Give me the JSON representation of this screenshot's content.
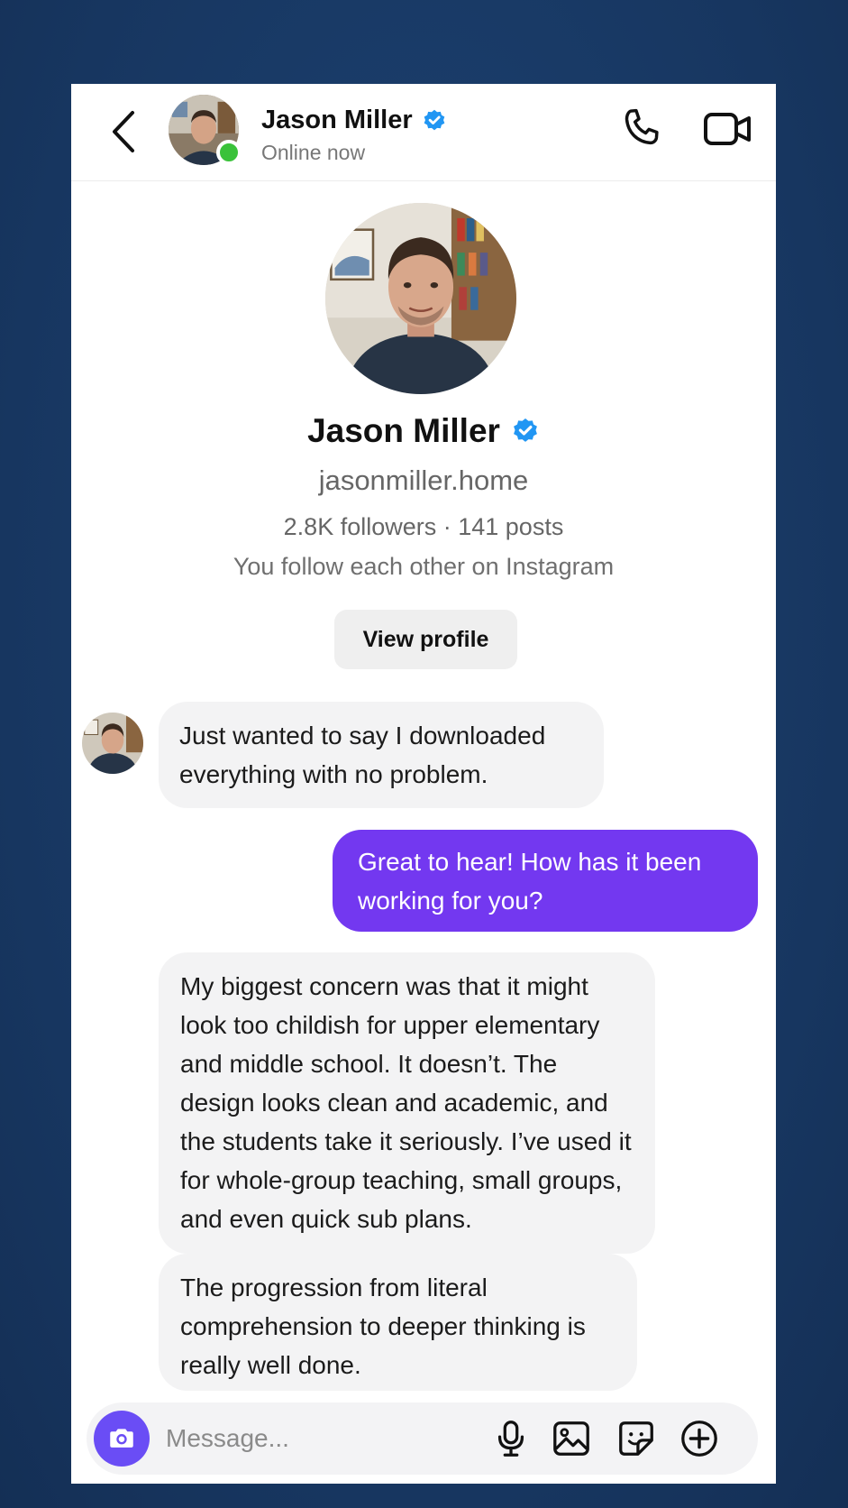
{
  "header": {
    "name": "Jason Miller",
    "status": "Online now"
  },
  "profile": {
    "name": "Jason Miller",
    "handle": "jasonmiller.home",
    "stats": "2.8K followers · 141 posts",
    "mutual": "You follow each other on Instagram",
    "view_profile_label": "View profile"
  },
  "messages": [
    {
      "direction": "incoming",
      "text": "Just wanted to say I downloaded everything with no problem."
    },
    {
      "direction": "outgoing",
      "text": "Great to hear! How has it been working for you?"
    },
    {
      "direction": "incoming",
      "text": "My biggest concern was that it might look too childish for upper elementary and middle school. It doesn’t. The design looks clean and academic, and the students take it seriously. I’ve used it for whole-group teaching, small groups, and even quick sub plans."
    },
    {
      "direction": "incoming",
      "text": "The progression from literal comprehension to deeper thinking is really well done."
    }
  ],
  "composer": {
    "placeholder": "Message...",
    "icons": [
      "camera-icon",
      "microphone-icon",
      "gallery-icon",
      "sticker-icon",
      "plus-icon"
    ]
  },
  "colors": {
    "background": "#1a3d6b",
    "accent": "#7338f0",
    "camera_button": "#6a4df5",
    "online": "#3ac23a",
    "verified": "#2196f3"
  }
}
